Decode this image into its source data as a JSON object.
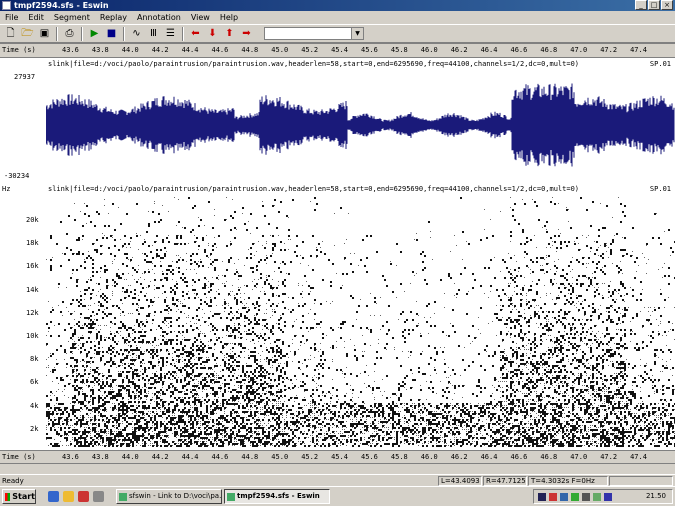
{
  "window": {
    "title": "tmpf2594.sfs - Eswin"
  },
  "menu": [
    "File",
    "Edit",
    "Segment",
    "Replay",
    "Annotation",
    "View",
    "Help"
  ],
  "toolbar": {
    "buttons": [
      "new-icon",
      "open-icon",
      "save-icon",
      "print-icon",
      "play-icon",
      "stop-icon",
      "waveform-icon",
      "bars-icon",
      "list-icon",
      "left-arrow-icon",
      "down-arrow-icon",
      "up-arrow-icon",
      "right-arrow-icon"
    ],
    "combo_value": ""
  },
  "timebar": {
    "label": "Time (s)",
    "ticks": [
      "43.6",
      "43.8",
      "44.0",
      "44.2",
      "44.4",
      "44.6",
      "44.8",
      "45.0",
      "45.2",
      "45.4",
      "45.6",
      "45.8",
      "46.0",
      "46.2",
      "46.4",
      "46.6",
      "46.8",
      "47.0",
      "47.2",
      "47.4"
    ]
  },
  "waveform": {
    "info": "slink|file=d:/voci/paolo/paraintrusion/paraintrusion.wav,headerlen=58,start=0,end=6295690,freq=44100,channels=1/2,dc=0,mult=0)",
    "tag": "SP.01",
    "ymax": "27937",
    "ymin": "-30234",
    "color": "#1a1a7a"
  },
  "spectrogram": {
    "unit": "Hz",
    "info": "slink|file=d:/voci/paolo/paraintrusion/paraintrusion.wav,headerlen=58,start=0,end=6295690,freq=44100,channels=1/2,dc=0,mult=0)",
    "tag": "SP.01",
    "yticks": [
      "20k",
      "18k",
      "16k",
      "14k",
      "12k",
      "10k",
      "8k",
      "6k",
      "4k",
      "2k"
    ]
  },
  "status": {
    "ready": "Ready",
    "left": "L=43.4093",
    "right": "R=47.7125",
    "time": "T=4.3032s F=0Hz"
  },
  "taskbar": {
    "start": "Start",
    "tasks": [
      "sfswin - Link to D:\\voci\\pa...",
      "tmpf2594.sfs - Eswin"
    ],
    "clock": "21.50"
  }
}
